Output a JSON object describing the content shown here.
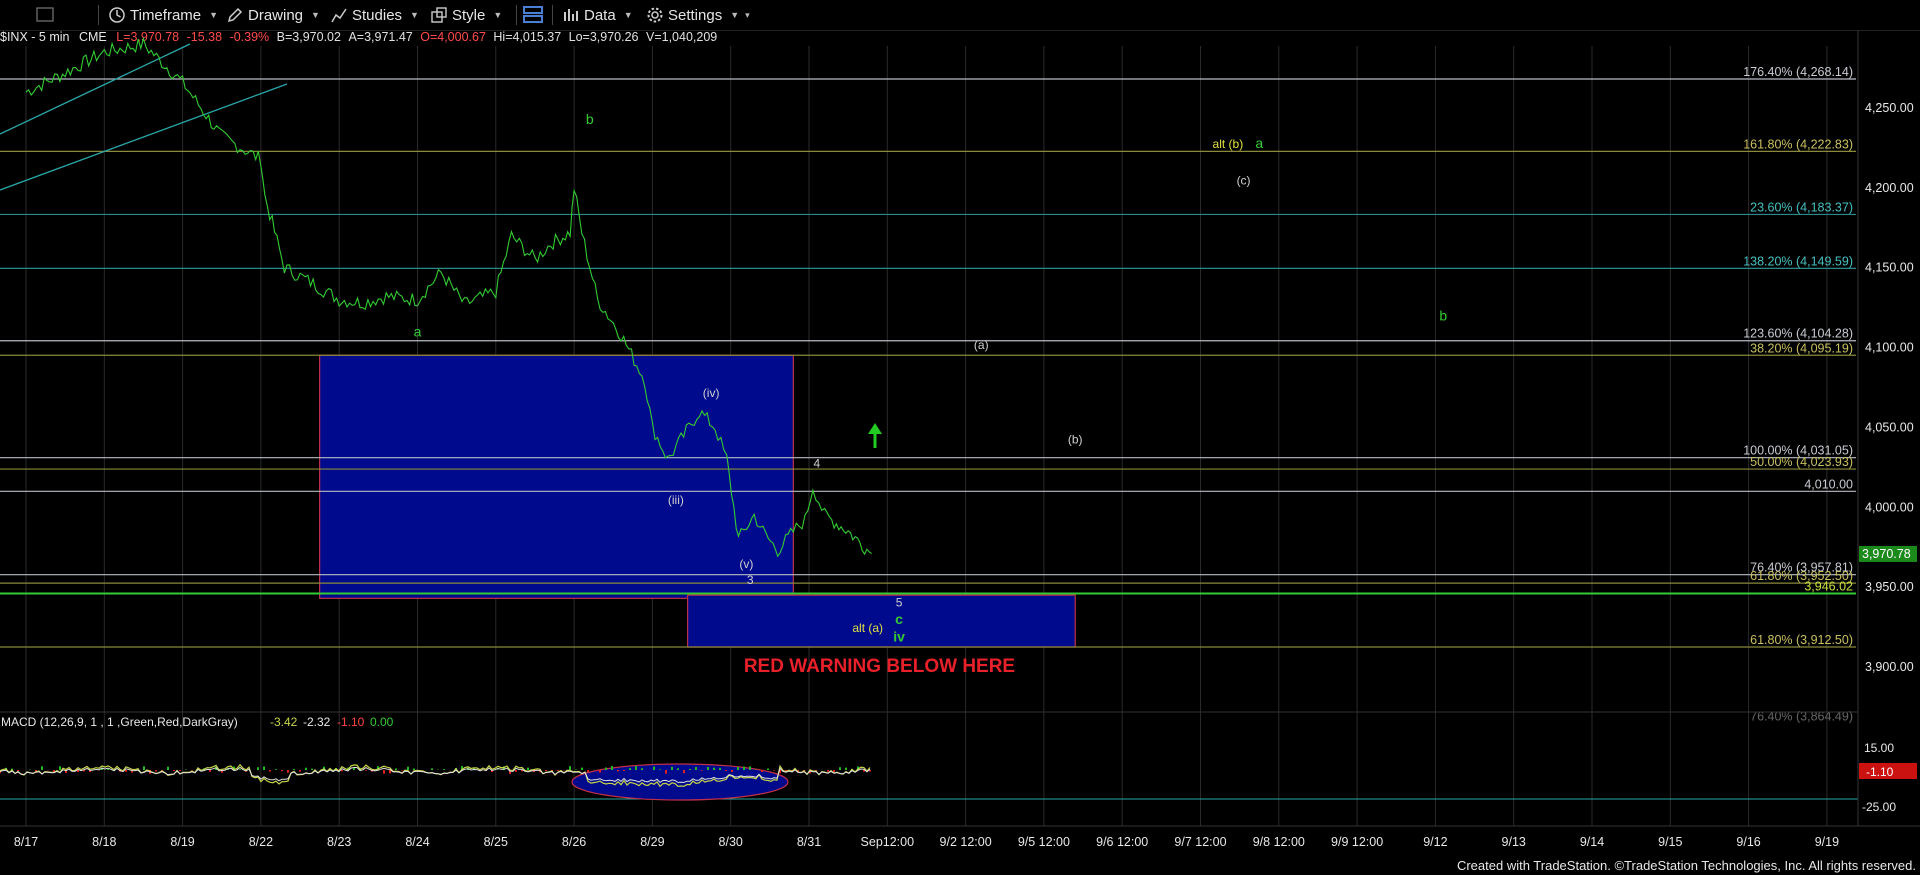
{
  "toolbar": {
    "timeframe": "Timeframe",
    "drawing": "Drawing",
    "studies": "Studies",
    "style": "Style",
    "data": "Data",
    "settings": "Settings"
  },
  "header": {
    "symbol": "$INX - 5 min",
    "exchange": "CME",
    "last": "L=3,970.78",
    "change": "-15.38",
    "change_pct": "-0.39%",
    "bid": "B=3,970.02",
    "ask": "A=3,971.47",
    "open": "O=4,000.67",
    "high": "Hi=4,015.37",
    "low": "Lo=3,970.26",
    "volume": "V=1,040,209"
  },
  "macd": {
    "title": "MACD (12,26,9, 1 , 1 ,Green,Red,DarkGray)",
    "v1": "-3.42",
    "v2": "-2.32",
    "v3": "-1.10",
    "v4": "0.00",
    "axis": [
      "15.00",
      "-25.00"
    ],
    "current": "-1.10"
  },
  "colors": {
    "background": "#000000",
    "price": "#33cc33",
    "box": "#000a8c",
    "box_border": "#c0304a",
    "warning": "#e8202a",
    "fib_line": "#b8bcc4",
    "teal_line": "#2aa7a9"
  },
  "footer": {
    "credit": "Created with TradeStation. ©TradeStation Technologies, Inc. All rights reserved."
  },
  "chart_data": {
    "type": "line",
    "title": "$INX - 5 min",
    "ylim": [
      3880,
      4300
    ],
    "x_ticks": [
      "8/17",
      "8/18",
      "8/19",
      "8/22",
      "8/23",
      "8/24",
      "8/25",
      "8/26",
      "8/29",
      "8/30",
      "8/31",
      "Sep12:00",
      "9/2 12:00",
      "9/5 12:00",
      "9/6 12:00",
      "9/7 12:00",
      "9/8 12:00",
      "9/9 12:00",
      "9/12",
      "9/13",
      "9/14",
      "9/15",
      "9/16",
      "9/19"
    ],
    "y_ticks": [
      "4,250.00",
      "4,200.00",
      "4,150.00",
      "4,100.00",
      "4,050.00",
      "4,000.00",
      "3,950.00",
      "3,900.00"
    ],
    "current_price_label": "3,970.78",
    "series": [
      {
        "values": [
          [
            0,
            4260
          ],
          [
            0.5,
            4272
          ],
          [
            1,
            4285
          ],
          [
            1.5,
            4290
          ],
          [
            2,
            4266
          ],
          [
            2.5,
            4232
          ],
          [
            3,
            4218
          ],
          [
            3.05,
            4195
          ],
          [
            3.3,
            4150
          ],
          [
            3.6,
            4142
          ],
          [
            4,
            4130
          ],
          [
            4.3,
            4128
          ],
          [
            4.6,
            4132
          ],
          [
            5,
            4130
          ],
          [
            5.3,
            4147
          ],
          [
            5.6,
            4127
          ],
          [
            6,
            4135
          ],
          [
            6.2,
            4170
          ],
          [
            6.5,
            4155
          ],
          [
            6.7,
            4165
          ],
          [
            6.95,
            4172
          ],
          [
            7.0,
            4200
          ],
          [
            7.1,
            4172
          ],
          [
            7.3,
            4130
          ],
          [
            7.6,
            4108
          ],
          [
            7.9,
            4080
          ],
          [
            8,
            4050
          ],
          [
            8.2,
            4030
          ],
          [
            8.4,
            4045
          ],
          [
            8.6,
            4060
          ],
          [
            8.8,
            4050
          ],
          [
            8.95,
            4030
          ],
          [
            9.1,
            3980
          ],
          [
            9.3,
            3995
          ],
          [
            9.45,
            3982
          ],
          [
            9.6,
            3973
          ],
          [
            9.8,
            3985
          ],
          [
            9.95,
            3992
          ],
          [
            10.05,
            4013
          ],
          [
            10.2,
            3995
          ],
          [
            10.35,
            3990
          ],
          [
            10.5,
            3985
          ],
          [
            10.65,
            3978
          ],
          [
            10.8,
            3971
          ]
        ]
      }
    ],
    "fib_levels": [
      {
        "label": "176.40% (4,268.14)",
        "value": 4268.14
      },
      {
        "label": "161.80% (4,222.83)",
        "value": 4222.83
      },
      {
        "label": "23.60% (4,183.37)",
        "value": 4183.37
      },
      {
        "label": "138.20% (4,149.59)",
        "value": 4149.59
      },
      {
        "label": "123.60% (4,104.28)",
        "value": 4104.28
      },
      {
        "label": "38.20% (4,095.19)",
        "value": 4095.19
      },
      {
        "label": "100.00% (4,031.05)",
        "value": 4031.05
      },
      {
        "label": "50.00% (4,023.93)",
        "value": 4023.93
      },
      {
        "label": "4,010.00",
        "value": 4010.0
      },
      {
        "label": "76.40% (3,957.81)",
        "value": 3957.81
      },
      {
        "label": "61.80% (3,952.50)",
        "value": 3952.5
      },
      {
        "label": "3,946.02",
        "value": 3946.02
      },
      {
        "label": "61.80% (3,912.50)",
        "value": 3912.5
      },
      {
        "label": "76.40% (3,864.49)",
        "value": 3864.49
      }
    ],
    "zones": [
      {
        "x_from": 3.75,
        "x_to": 9.8,
        "y_from": 3943.0,
        "y_to": 4095.19
      },
      {
        "x_from": 8.45,
        "x_to": 13.4,
        "y_from": 3912.5,
        "y_to": 3945.0
      }
    ],
    "annotations": [
      {
        "text": "b",
        "x": 7.2,
        "y": 4240
      },
      {
        "text": "a",
        "x": 5.0,
        "y": 4107
      },
      {
        "text": "(iv)",
        "x": 8.75,
        "y": 4069
      },
      {
        "text": "(iii)",
        "x": 8.3,
        "y": 4002
      },
      {
        "text": "(v)",
        "x": 9.2,
        "y": 3962
      },
      {
        "text": "3",
        "x": 9.25,
        "y": 3952
      },
      {
        "text": "4",
        "x": 10.1,
        "y": 4025
      },
      {
        "text": "5",
        "x": 11.15,
        "y": 3938
      },
      {
        "text": "c",
        "x": 11.15,
        "y": 3927
      },
      {
        "text": "iv",
        "x": 11.15,
        "y": 3916
      },
      {
        "text": "alt (a)",
        "x": 10.75,
        "y": 3922
      },
      {
        "text": "(a)",
        "x": 12.2,
        "y": 4099
      },
      {
        "text": "(b)",
        "x": 13.4,
        "y": 4040
      },
      {
        "text": "alt (b)",
        "x": 15.35,
        "y": 4225
      },
      {
        "text": "a",
        "x": 15.75,
        "y": 4225
      },
      {
        "text": "(c)",
        "x": 15.55,
        "y": 4202
      },
      {
        "text": "b",
        "x": 18.1,
        "y": 4117
      },
      {
        "text": "RED WARNING BELOW HERE",
        "x": 10.9,
        "y": 3897
      }
    ]
  }
}
